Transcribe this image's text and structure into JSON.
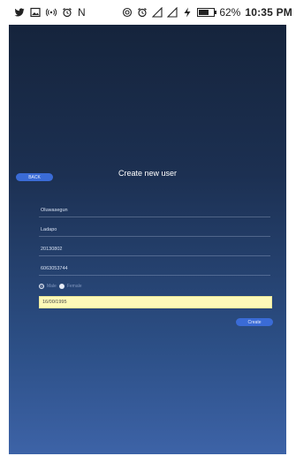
{
  "status_bar": {
    "left_icons": [
      "twitter-icon",
      "gallery-icon",
      "hotspot-icon",
      "alarm-icon",
      "n-icon"
    ],
    "n_label": "N",
    "right_icons": [
      "nfc-icon",
      "alarm-icon",
      "signal-icon",
      "signal-icon",
      "charging-icon",
      "battery-icon"
    ],
    "battery_percent": "62%",
    "time": "10:35 PM"
  },
  "screen": {
    "back_label": "BACK",
    "title": "Create new user",
    "fields": [
      {
        "value": "Oluwasegun"
      },
      {
        "value": "Ladapo"
      },
      {
        "value": "20130802"
      },
      {
        "value": "6063053744"
      }
    ],
    "gender": {
      "options": [
        "Male",
        "Female"
      ],
      "selected": "Male"
    },
    "date_value": "16/00/1995",
    "create_label": "Create"
  },
  "colors": {
    "gradient_top": "#15243c",
    "gradient_bottom": "#3d63a7",
    "button": "#3a6bd6",
    "date_bg": "#fdf9b8"
  }
}
